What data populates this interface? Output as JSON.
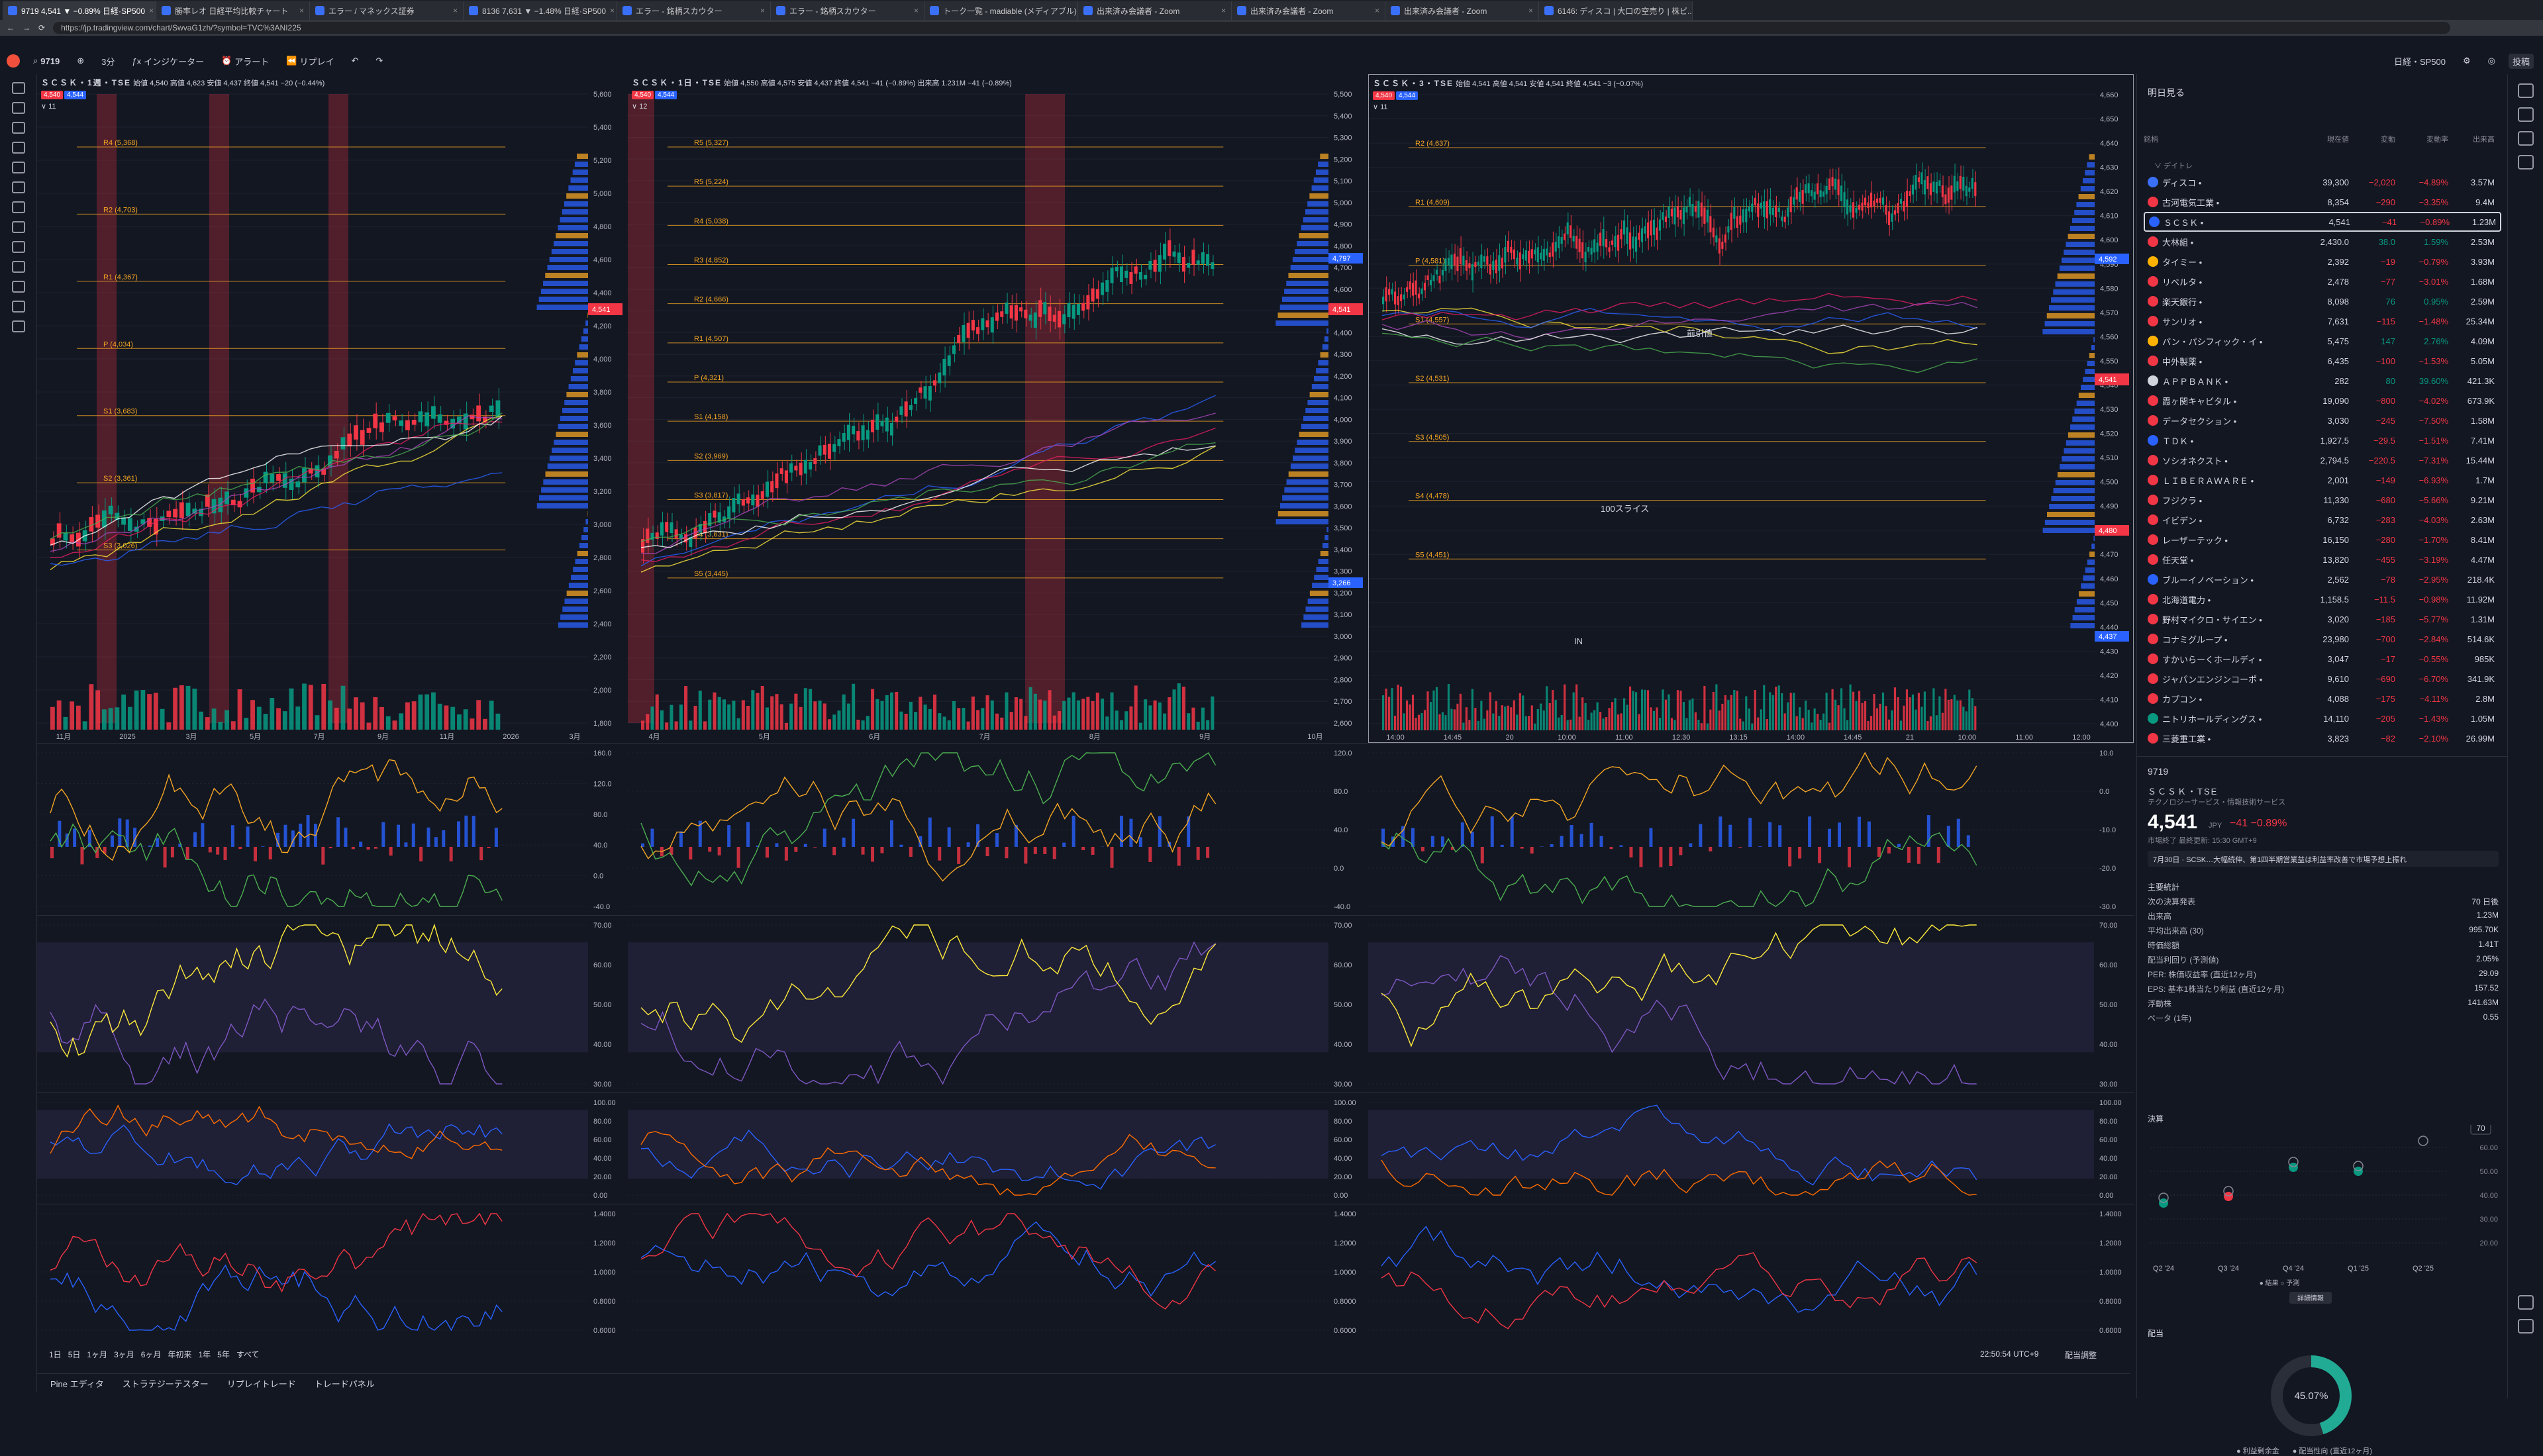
{
  "browser": {
    "tabs": [
      {
        "title": "9719 4,541 ▼ −0.89% 日経·SP500"
      },
      {
        "title": "勝率レオ 日経平均比較チャート"
      },
      {
        "title": "エラー / マネックス証券"
      },
      {
        "title": "8136 7,631 ▼ −1.48% 日経·SP500"
      },
      {
        "title": "エラー - 銘柄スカウター"
      },
      {
        "title": "エラー - 銘柄スカウター"
      },
      {
        "title": "トーク一覧 - madiable (メディアブル)"
      },
      {
        "title": "出来済み会議者 - Zoom"
      },
      {
        "title": "出来済み会議者 - Zoom"
      },
      {
        "title": "出来済み会議者 - Zoom"
      },
      {
        "title": "6146: ディスコ | 大口の空売り | 株ビ..."
      }
    ],
    "url": "https://jp.tradingview.com/chart/SwvaG1zh/?symbol=TVC%3ANI225"
  },
  "toolbar": {
    "symbol": "9719",
    "interval": "3分",
    "indicators": "インジケーター",
    "alert": "アラート",
    "replay": "リプレイ",
    "layout_name": "日経・SP500",
    "publish": "投稿"
  },
  "panes": [
    {
      "title": "ＳＣＳＫ・1週・TSE",
      "ohlc": "始値 4,540 高値 4,623 安値 4,437 終値 4,541 −20 (−0.44%)",
      "bid": "4,540",
      "ask": "4,544",
      "legend_count": "11",
      "price_tag": "4,541",
      "yticks": [
        "5,600",
        "5,400",
        "5,200",
        "5,000",
        "4,800",
        "4,600",
        "4,400",
        "4,200",
        "4,000",
        "3,800",
        "3,600",
        "3,400",
        "3,200",
        "3,000",
        "2,800",
        "2,600",
        "2,400",
        "2,200",
        "2,000",
        "1,800"
      ],
      "xticks": [
        "11月",
        "2025",
        "3月",
        "5月",
        "7月",
        "9月",
        "11月",
        "2026",
        "3月"
      ],
      "pivots": [
        "R4 (5,368)",
        "R2 (4,703)",
        "R1 (4,367)",
        "P (4,034)",
        "S1 (3,683)",
        "S2 (3,361)",
        "S3 (3,026)"
      ]
    },
    {
      "title": "ＳＣＳＫ・1日・TSE",
      "ohlc": "始値 4,550 高値 4,575 安値 4,437 終値 4,541 −41 (−0.89%) 出来高 1.231M −41 (−0.89%)",
      "bid": "4,540",
      "ask": "4,544",
      "legend_count": "12",
      "price_tag": "4,541",
      "yticks": [
        "5,500",
        "5,400",
        "5,300",
        "5,200",
        "5,100",
        "5,000",
        "4,900",
        "4,800",
        "4,700",
        "4,600",
        "4,500",
        "4,400",
        "4,300",
        "4,200",
        "4,100",
        "4,000",
        "3,900",
        "3,800",
        "3,700",
        "3,600",
        "3,500",
        "3,400",
        "3,300",
        "3,200",
        "3,100",
        "3,000",
        "2,900",
        "2,800",
        "2,700",
        "2,600"
      ],
      "xticks": [
        "4月",
        "5月",
        "6月",
        "7月",
        "8月",
        "9月",
        "10月"
      ],
      "pivots": [
        "R5 (5,327)",
        "R5 (5,224)",
        "R4 (5,038)",
        "R3 (4,852)",
        "R2 (4,666)",
        "R1 (4,507)",
        "P (4,321)",
        "S1 (4,158)",
        "S2 (3,969)",
        "S3 (3,817)",
        "S4 (3,631)",
        "S5 (3,445)"
      ],
      "hi_label": "4,797",
      "lo_label": "3,266"
    },
    {
      "title": "ＳＣＳＫ・3・TSE",
      "ohlc": "始値 4,541 高値 4,541 安値 4,541 終値 4,541 −3 (−0.07%)",
      "bid": "4,540",
      "ask": "4,544",
      "legend_count": "11",
      "price_tag": "4,541",
      "yticks": [
        "4,660",
        "4,650",
        "4,640",
        "4,630",
        "4,620",
        "4,610",
        "4,600",
        "4,590",
        "4,580",
        "4,570",
        "4,560",
        "4,550",
        "4,540",
        "4,530",
        "4,520",
        "4,510",
        "4,500",
        "4,490",
        "4,480",
        "4,470",
        "4,460",
        "4,450",
        "4,440",
        "4,430",
        "4,420",
        "4,410",
        "4,400"
      ],
      "xticks": [
        "14:00",
        "14:45",
        "20",
        "10:00",
        "11:00",
        "12:30",
        "13:15",
        "14:00",
        "14:45",
        "21",
        "10:00",
        "11:00",
        "12:00"
      ],
      "pivots": [
        "R2 (4,637)",
        "R1 (4,609)",
        "P (4,581)",
        "S1 (4,557)",
        "S2 (4,531)",
        "S3 (4,505)",
        "S4 (4,478)",
        "S5 (4,451)"
      ],
      "annotations": [
        "前引値",
        "100スライス",
        "IN"
      ],
      "hi_label": "4,592",
      "lo_label": "4,437",
      "red_tag": "4,480"
    }
  ],
  "osc_ticks": {
    "macd1": [
      "160.0",
      "120.0",
      "80.0",
      "40.0",
      "0.0",
      "-40.0"
    ],
    "macd2": [
      "120.0",
      "80.0",
      "40.0",
      "0.0",
      "-40.0"
    ],
    "macd3": [
      "10.0",
      "0.0",
      "-10.0",
      "-20.0",
      "-30.0"
    ],
    "rsi": [
      "70.00",
      "60.00",
      "50.00",
      "40.00",
      "30.00"
    ],
    "stoch": [
      "100.00",
      "80.00",
      "60.00",
      "40.00",
      "20.00",
      "0.00"
    ],
    "ratio": [
      "1.4000",
      "1.2000",
      "1.0000",
      "0.8000",
      "0.6000"
    ]
  },
  "bottom": {
    "ranges": [
      "1日",
      "5日",
      "1ヶ月",
      "3ヶ月",
      "6ヶ月",
      "年初来",
      "1年",
      "5年",
      "すべて"
    ],
    "clock": "22:50:54 UTC+9",
    "adjust": "配当調整",
    "panels": [
      "Pine エディタ",
      "ストラテジーテスター",
      "リプレイトレード",
      "トレードパネル"
    ]
  },
  "watchlist": {
    "title": "明日見る",
    "columns": [
      "銘柄",
      "現在値",
      "変動",
      "変動率",
      "出来高"
    ],
    "section": "デイトレ",
    "rows": [
      {
        "name": "ディスコ",
        "last": "39,300",
        "chg": "−2,020",
        "pct": "−4.89%",
        "vol": "3.57M",
        "dir": "dn",
        "color": "#3a6ff7"
      },
      {
        "name": "古河電気工業",
        "last": "8,354",
        "chg": "−290",
        "pct": "−3.35%",
        "vol": "9.4M",
        "dir": "dn",
        "color": "#f23645"
      },
      {
        "name": "ＳＣＳＫ",
        "last": "4,541",
        "chg": "−41",
        "pct": "−0.89%",
        "vol": "1.23M",
        "dir": "dn",
        "color": "#2962ff",
        "selected": true
      },
      {
        "name": "大林組",
        "last": "2,430.0",
        "chg": "38.0",
        "pct": "1.59%",
        "vol": "2.53M",
        "dir": "up",
        "color": "#f23645"
      },
      {
        "name": "タイミー",
        "last": "2,392",
        "chg": "−19",
        "pct": "−0.79%",
        "vol": "3.93M",
        "dir": "dn",
        "color": "#ffb300"
      },
      {
        "name": "リベルタ",
        "last": "2,478",
        "chg": "−77",
        "pct": "−3.01%",
        "vol": "1.68M",
        "dir": "dn",
        "color": "#f23645"
      },
      {
        "name": "楽天銀行",
        "last": "8,098",
        "chg": "76",
        "pct": "0.95%",
        "vol": "2.59M",
        "dir": "up",
        "color": "#f23645"
      },
      {
        "name": "サンリオ",
        "last": "7,631",
        "chg": "−115",
        "pct": "−1.48%",
        "vol": "25.34M",
        "dir": "dn",
        "color": "#f23645"
      },
      {
        "name": "パン・パシフィック・イ",
        "last": "5,475",
        "chg": "147",
        "pct": "2.76%",
        "vol": "4.09M",
        "dir": "up",
        "color": "#ffb300"
      },
      {
        "name": "中外製薬",
        "last": "6,435",
        "chg": "−100",
        "pct": "−1.53%",
        "vol": "5.05M",
        "dir": "dn",
        "color": "#f23645"
      },
      {
        "name": "ＡＰＰＢＡＮＫ",
        "last": "282",
        "chg": "80",
        "pct": "39.60%",
        "vol": "421.3K",
        "dir": "up",
        "color": "#d1d4dc"
      },
      {
        "name": "霞ヶ関キャピタル",
        "last": "19,090",
        "chg": "−800",
        "pct": "−4.02%",
        "vol": "673.9K",
        "dir": "dn",
        "color": "#f23645"
      },
      {
        "name": "データセクション",
        "last": "3,030",
        "chg": "−245",
        "pct": "−7.50%",
        "vol": "1.58M",
        "dir": "dn",
        "color": "#f23645"
      },
      {
        "name": "ＴＤＫ",
        "last": "1,927.5",
        "chg": "−29.5",
        "pct": "−1.51%",
        "vol": "7.41M",
        "dir": "dn",
        "color": "#2962ff"
      },
      {
        "name": "ソシオネクスト",
        "last": "2,794.5",
        "chg": "−220.5",
        "pct": "−7.31%",
        "vol": "15.44M",
        "dir": "dn",
        "color": "#f23645"
      },
      {
        "name": "ＬＩＢＥＲＡＷＡＲＥ",
        "last": "2,001",
        "chg": "−149",
        "pct": "−6.93%",
        "vol": "1.7M",
        "dir": "dn",
        "color": "#f23645"
      },
      {
        "name": "フジクラ",
        "last": "11,330",
        "chg": "−680",
        "pct": "−5.66%",
        "vol": "9.21M",
        "dir": "dn",
        "color": "#f23645"
      },
      {
        "name": "イビデン",
        "last": "6,732",
        "chg": "−283",
        "pct": "−4.03%",
        "vol": "2.63M",
        "dir": "dn",
        "color": "#f23645"
      },
      {
        "name": "レーザーテック",
        "last": "16,150",
        "chg": "−280",
        "pct": "−1.70%",
        "vol": "8.41M",
        "dir": "dn",
        "color": "#f23645"
      },
      {
        "name": "任天堂",
        "last": "13,820",
        "chg": "−455",
        "pct": "−3.19%",
        "vol": "4.47M",
        "dir": "dn",
        "color": "#f23645"
      },
      {
        "name": "ブルーイノベーション",
        "last": "2,562",
        "chg": "−78",
        "pct": "−2.95%",
        "vol": "218.4K",
        "dir": "dn",
        "color": "#2962ff"
      },
      {
        "name": "北海道電力",
        "last": "1,158.5",
        "chg": "−11.5",
        "pct": "−0.98%",
        "vol": "11.92M",
        "dir": "dn",
        "color": "#f23645"
      },
      {
        "name": "野村マイクロ・サイエン",
        "last": "3,020",
        "chg": "−185",
        "pct": "−5.77%",
        "vol": "1.31M",
        "dir": "dn",
        "color": "#f23645"
      },
      {
        "name": "コナミグループ",
        "last": "23,980",
        "chg": "−700",
        "pct": "−2.84%",
        "vol": "514.6K",
        "dir": "dn",
        "color": "#f23645"
      },
      {
        "name": "すかいらーくホールディ",
        "last": "3,047",
        "chg": "−17",
        "pct": "−0.55%",
        "vol": "985K",
        "dir": "dn",
        "color": "#f23645"
      },
      {
        "name": "ジャパンエンジンコーポ",
        "last": "9,610",
        "chg": "−690",
        "pct": "−6.70%",
        "vol": "341.9K",
        "dir": "dn",
        "color": "#f23645"
      },
      {
        "name": "カプコン",
        "last": "4,088",
        "chg": "−175",
        "pct": "−4.11%",
        "vol": "2.8M",
        "dir": "dn",
        "color": "#f23645"
      },
      {
        "name": "ニトリホールディングス",
        "last": "14,110",
        "chg": "−205",
        "pct": "−1.43%",
        "vol": "1.05M",
        "dir": "dn",
        "color": "#089981"
      },
      {
        "name": "三菱重工業",
        "last": "3,823",
        "chg": "−82",
        "pct": "−2.10%",
        "vol": "26.99M",
        "dir": "dn",
        "color": "#f23645"
      }
    ]
  },
  "detail": {
    "symbol": "9719",
    "name": "ＳＣＳＫ・TSE",
    "sector": "テクノロジーサービス・情報技術サービス",
    "price": "4,541",
    "unit": "JPY",
    "change": "−41 −0.89%",
    "state": "市場終了  最終更新: 15:30 GMT+9",
    "news": "7月30日 · SCSK…大幅続伸、第1四半期営業益は利益率改善で市場予想上振れ",
    "stats_title": "主要統計",
    "stats": [
      {
        "k": "次の決算発表",
        "v": "70 日後"
      },
      {
        "k": "出来高",
        "v": "1.23M"
      },
      {
        "k": "平均出来高 (30)",
        "v": "995.70K"
      },
      {
        "k": "時価総額",
        "v": "1.41T"
      },
      {
        "k": "配当利回り (予測値)",
        "v": "2.05%"
      },
      {
        "k": "PER: 株価収益率 (直近12ヶ月)",
        "v": "29.09"
      },
      {
        "k": "EPS: 基本1株当たり利益 (直近12ヶ月)",
        "v": "157.52"
      },
      {
        "k": "浮動株",
        "v": "141.63M"
      },
      {
        "k": "ベータ (1年)",
        "v": "0.55"
      }
    ],
    "earnings_title": "決算",
    "earnings_badge": "70",
    "earnings_ticks": [
      "60.00",
      "50.00",
      "40.00",
      "30.00",
      "20.00"
    ],
    "earnings_quarters": [
      "Q2 '24",
      "Q3 '24",
      "Q4 '24",
      "Q1 '25",
      "Q2 '25"
    ],
    "earnings_legend": [
      "● 結果",
      "○ 予測"
    ],
    "earnings_button": "詳細情報",
    "dividend_title": "配当",
    "payout_pct": "45.07%",
    "payout_value": 0.4507,
    "dividend_legend": [
      "● 利益剰余金",
      "● 配当性向 (直近12ヶ月)"
    ]
  }
}
